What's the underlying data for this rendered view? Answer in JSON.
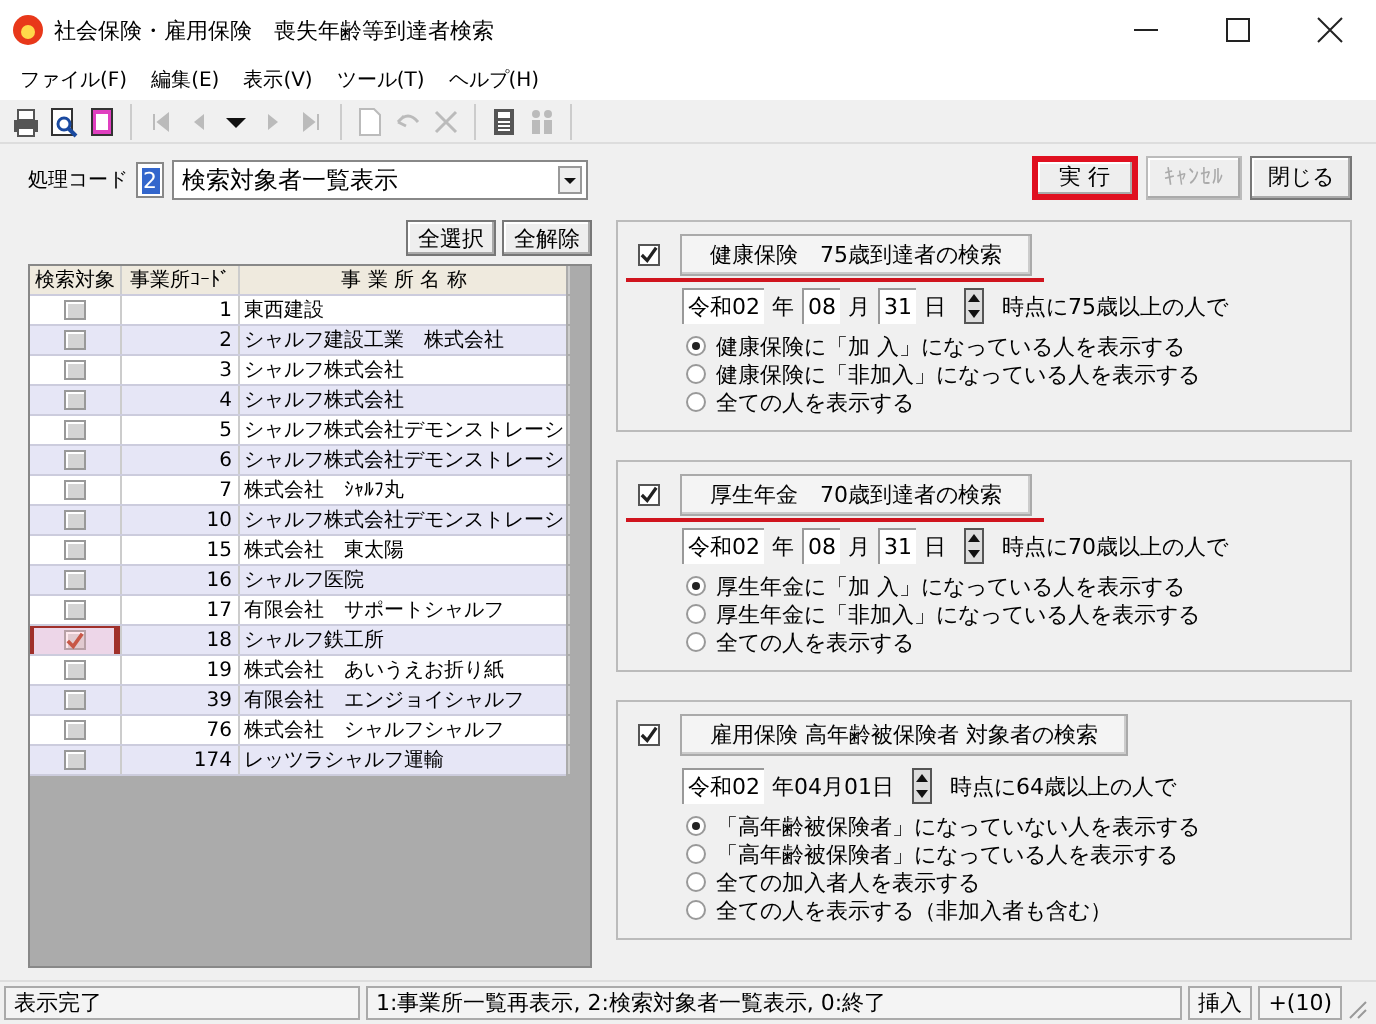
{
  "window": {
    "title": "社会保険・雇用保険　喪失年齢等到達者検索"
  },
  "menu": [
    "ファイル(F)",
    "編集(E)",
    "表示(V)",
    "ツール(T)",
    "ヘルプ(H)"
  ],
  "process": {
    "label": "処理コード",
    "code": "2",
    "selection": "検索対象者一覧表示"
  },
  "actions": [
    {
      "label": "実 行",
      "disabled": false,
      "highlighted": true
    },
    {
      "label": "ｷｬﾝｾﾙ",
      "disabled": true,
      "highlighted": false
    },
    {
      "label": "閉じる",
      "disabled": false,
      "highlighted": false
    }
  ],
  "select_buttons": [
    "全選択",
    "全解除"
  ],
  "table": {
    "columns": [
      "検索対象",
      "事業所ｺｰﾄﾞ",
      "事 業 所 名 称"
    ],
    "rows": [
      {
        "checked": false,
        "highlighted": false,
        "code": "1",
        "name": "東西建設"
      },
      {
        "checked": false,
        "highlighted": false,
        "code": "2",
        "name": "シャルフ建設工業　株式会社"
      },
      {
        "checked": false,
        "highlighted": false,
        "code": "3",
        "name": "シャルフ株式会社"
      },
      {
        "checked": false,
        "highlighted": false,
        "code": "4",
        "name": "シャルフ株式会社"
      },
      {
        "checked": false,
        "highlighted": false,
        "code": "5",
        "name": "シャルフ株式会社デモンストレーシ"
      },
      {
        "checked": false,
        "highlighted": false,
        "code": "6",
        "name": "シャルフ株式会社デモンストレーシ"
      },
      {
        "checked": false,
        "highlighted": false,
        "code": "7",
        "name": "株式会社　ｼｬﾙﾌ丸"
      },
      {
        "checked": false,
        "highlighted": false,
        "code": "10",
        "name": "シャルフ株式会社デモンストレーシ"
      },
      {
        "checked": false,
        "highlighted": false,
        "code": "15",
        "name": "株式会社　東太陽"
      },
      {
        "checked": false,
        "highlighted": false,
        "code": "16",
        "name": "シャルフ医院"
      },
      {
        "checked": false,
        "highlighted": false,
        "code": "17",
        "name": "有限会社　サポートシャルフ"
      },
      {
        "checked": true,
        "highlighted": true,
        "code": "18",
        "name": "シャルフ鉄工所"
      },
      {
        "checked": false,
        "highlighted": false,
        "code": "19",
        "name": "株式会社　あいうえお折り紙"
      },
      {
        "checked": false,
        "highlighted": false,
        "code": "39",
        "name": "有限会社　エンジョイシャルフ"
      },
      {
        "checked": false,
        "highlighted": false,
        "code": "76",
        "name": "株式会社　シャルフシャルフ"
      },
      {
        "checked": false,
        "highlighted": false,
        "code": "174",
        "name": "レッツラシャルフ運輸"
      }
    ]
  },
  "panels": [
    {
      "checked": true,
      "title": "健康保険　75歳到達者の検索",
      "underlined": true,
      "date": [
        {
          "kind": "field",
          "text": "令和02"
        },
        {
          "kind": "label",
          "text": "年"
        },
        {
          "kind": "field",
          "text": "08"
        },
        {
          "kind": "label",
          "text": "月"
        },
        {
          "kind": "field",
          "text": "31"
        },
        {
          "kind": "label",
          "text": "日"
        }
      ],
      "condition": "時点に75歳以上の人で",
      "options": [
        {
          "label": "健康保険に「加 入」になっている人を表示する",
          "selected": true
        },
        {
          "label": "健康保険に「非加入」になっている人を表示する",
          "selected": false
        },
        {
          "label": "全ての人を表示する",
          "selected": false
        }
      ]
    },
    {
      "checked": true,
      "title": "厚生年金　70歳到達者の検索",
      "underlined": true,
      "date": [
        {
          "kind": "field",
          "text": "令和02"
        },
        {
          "kind": "label",
          "text": "年"
        },
        {
          "kind": "field",
          "text": "08"
        },
        {
          "kind": "label",
          "text": "月"
        },
        {
          "kind": "field",
          "text": "31"
        },
        {
          "kind": "label",
          "text": "日"
        }
      ],
      "condition": "時点に70歳以上の人で",
      "options": [
        {
          "label": "厚生年金に「加 入」になっている人を表示する",
          "selected": true
        },
        {
          "label": "厚生年金に「非加入」になっている人を表示する",
          "selected": false
        },
        {
          "label": "全ての人を表示する",
          "selected": false
        }
      ]
    },
    {
      "checked": true,
      "title": "雇用保険 高年齢被保険者 対象者の検索",
      "underlined": false,
      "date": [
        {
          "kind": "field",
          "text": "令和02"
        },
        {
          "kind": "label",
          "text": "年04月01日"
        }
      ],
      "condition": "時点に64歳以上の人で",
      "options": [
        {
          "label": "「高年齢被保険者」になっていない人を表示する",
          "selected": true
        },
        {
          "label": "「高年齢被保険者」になっている人を表示する",
          "selected": false
        },
        {
          "label": "全ての加入者人を表示する",
          "selected": false
        },
        {
          "label": "全ての人を表示する（非加入者も含む）",
          "selected": false
        }
      ]
    }
  ],
  "status_bar": {
    "message": "表示完了",
    "hint": "1:事業所一覧再表示, 2:検索対象者一覧表示, 0:終了",
    "mode": "挿入",
    "count": "+(10)"
  }
}
